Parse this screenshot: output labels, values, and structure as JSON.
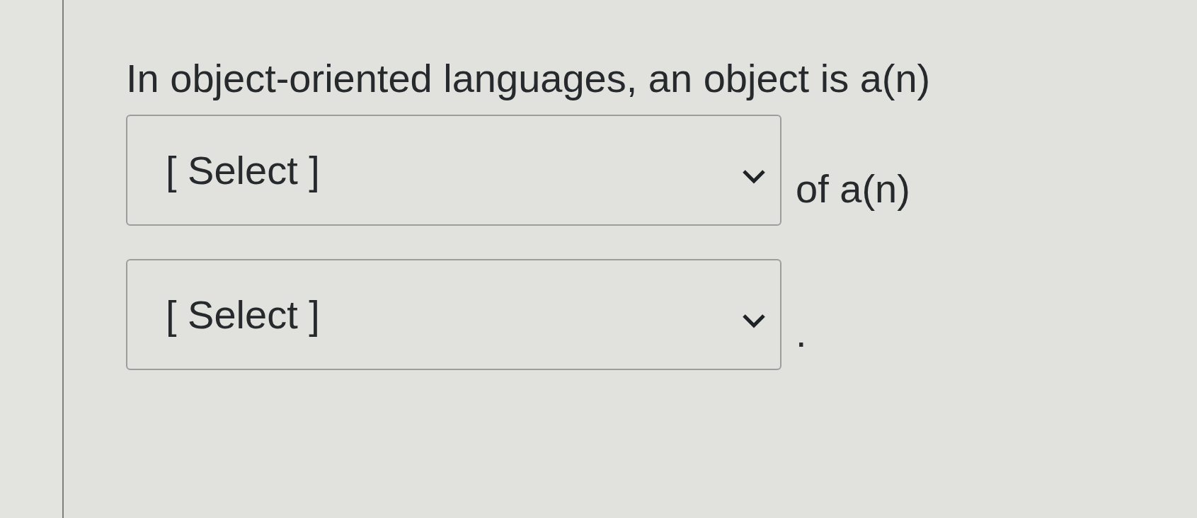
{
  "question": {
    "segments": [
      {
        "kind": "text",
        "text": "In object-oriented languages, an object is a(n)"
      },
      {
        "kind": "dropdown",
        "value": "[ Select ]"
      },
      {
        "kind": "text",
        "text": "of a(n)"
      },
      {
        "kind": "dropdown",
        "value": "[ Select ]"
      },
      {
        "kind": "text",
        "text": "."
      }
    ]
  }
}
